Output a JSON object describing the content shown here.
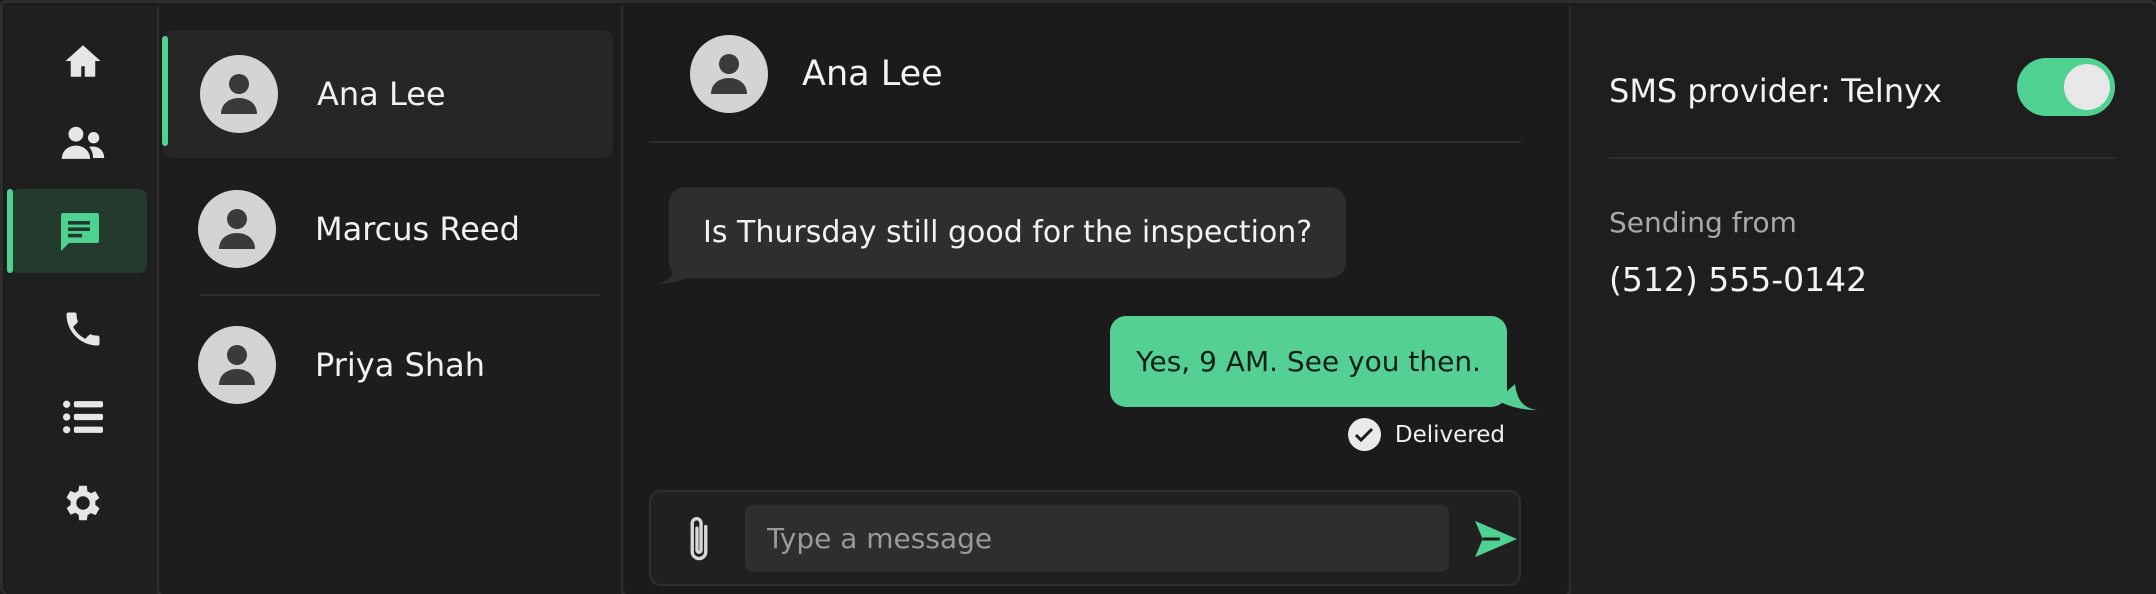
{
  "nav": {
    "items": [
      {
        "id": "home",
        "icon": "home-icon"
      },
      {
        "id": "contacts",
        "icon": "contacts-icon"
      },
      {
        "id": "messages",
        "icon": "message-icon",
        "active": true
      },
      {
        "id": "calls",
        "icon": "phone-icon"
      },
      {
        "id": "list",
        "icon": "list-icon"
      },
      {
        "id": "settings",
        "icon": "gear-icon"
      }
    ]
  },
  "conversations": [
    {
      "name": "Ana Lee",
      "active": true
    },
    {
      "name": "Marcus Reed"
    },
    {
      "name": "Priya Shah"
    }
  ],
  "chat": {
    "contact_name": "Ana Lee",
    "messages": [
      {
        "direction": "incoming",
        "text": "Is Thursday still good for the inspection?"
      },
      {
        "direction": "outgoing",
        "text": "Yes, 9 AM. See you then.",
        "status": "Delivered"
      }
    ],
    "composer": {
      "placeholder": "Type a message",
      "value": ""
    }
  },
  "settings": {
    "provider_label": "SMS provider: Telnyx",
    "provider_enabled": true,
    "sending_from_label": "Sending from",
    "sending_from_number": "(512) 555-0142"
  },
  "colors": {
    "accent": "#4fd192",
    "outgoing_bubble": "#55d095",
    "incoming_bubble": "#2e2e2e",
    "background": "#1c1c1c"
  }
}
